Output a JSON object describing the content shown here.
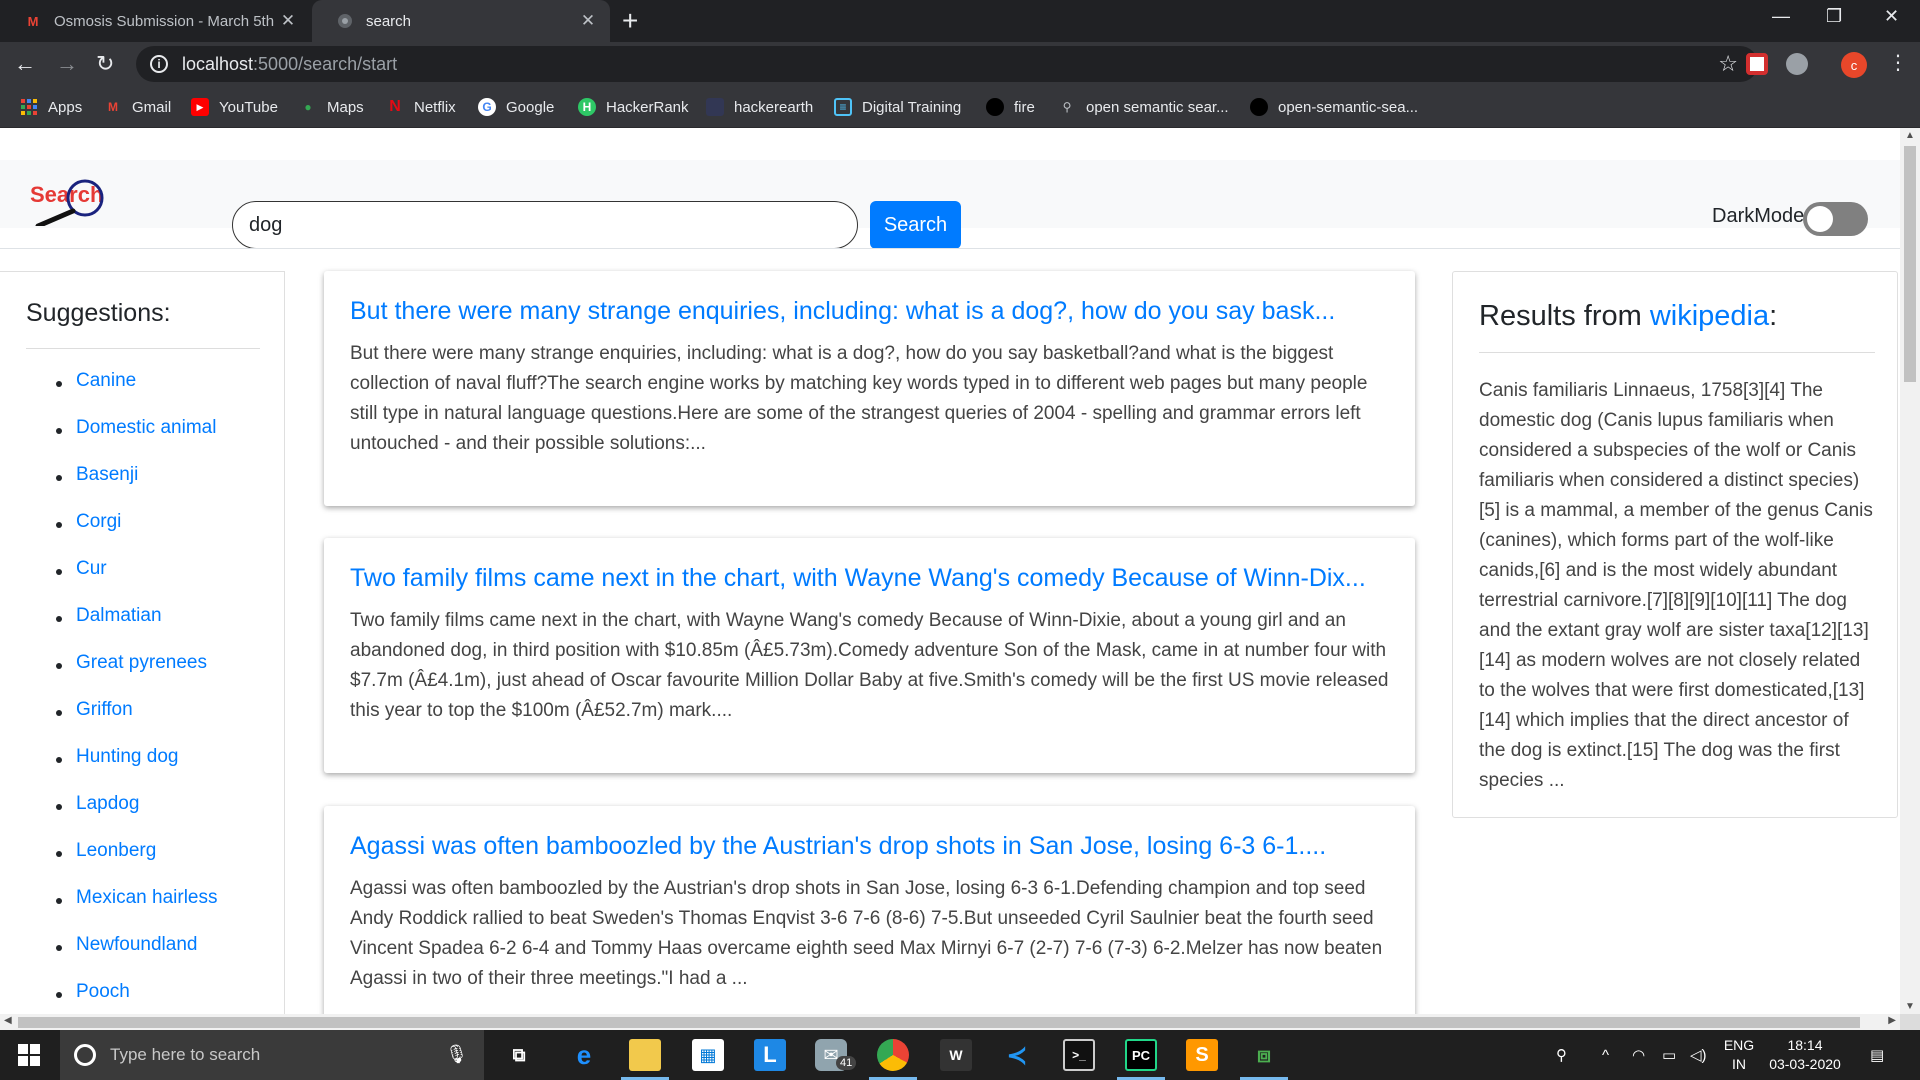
{
  "browser": {
    "tabs": [
      {
        "title": "Osmosis Submission - March 5th",
        "icon": "gmail-icon"
      },
      {
        "title": "search",
        "icon": "globe-icon"
      }
    ],
    "url_host": "localhost",
    "url_path": ":5000/search/start",
    "bookmarks": [
      "Apps",
      "Gmail",
      "YouTube",
      "Maps",
      "Netflix",
      "Google",
      "HackerRank",
      "hackerearth",
      "Digital Training",
      "fire",
      "open semantic sear...",
      "open-semantic-sea..."
    ],
    "profile_initial": "c"
  },
  "header": {
    "logo_text": "Search",
    "search_value": "dog",
    "search_button": "Search",
    "darkmode_label": "DarkMode",
    "darkmode_on": false
  },
  "suggestions": {
    "title": "Suggestions:",
    "items": [
      "Canine",
      "Domestic animal",
      "Basenji",
      "Corgi",
      "Cur",
      "Dalmatian",
      "Great pyrenees",
      "Griffon",
      "Hunting dog",
      "Lapdog",
      "Leonberg",
      "Mexican hairless",
      "Newfoundland",
      "Pooch"
    ]
  },
  "results": [
    {
      "title": "But there were many strange enquiries, including: what is a dog?, how do you say bask...",
      "snippet": "But there were many strange enquiries, including: what is a dog?, how do you say basketball?and what is the biggest collection of naval fluff?The search engine works by matching key words typed in to different web pages but many people still type in natural language questions.Here are some of the strangest queries of 2004 - spelling and grammar errors left untouched - and their possible solutions:..."
    },
    {
      "title": "Two family films came next in the chart, with Wayne Wang's comedy Because of Winn-Dix...",
      "snippet": "Two family films came next in the chart, with Wayne Wang's comedy Because of Winn-Dixie, about a young girl and an abandoned dog, in third position with $10.85m (Â£5.73m).Comedy adventure Son of the Mask, came in at number four with $7.7m (Â£4.1m), just ahead of Oscar favourite Million Dollar Baby at five.Smith's comedy will be the first US movie released this year to top the $100m (Â£52.7m) mark...."
    },
    {
      "title": "Agassi was often bamboozled by the Austrian's drop shots in San Jose, losing 6-3 6-1....",
      "snippet": "Agassi was often bamboozled by the Austrian's drop shots in San Jose, losing 6-3 6-1.Defending champion and top seed Andy Roddick rallied to beat Sweden's Thomas Enqvist 3-6 7-6 (8-6) 7-5.But unseeded Cyril Saulnier beat the fourth seed Vincent Spadea 6-2 6-4 and Tommy Haas overcame eighth seed Max Mirnyi 6-7 (2-7) 7-6 (7-3) 6-2.Melzer has now beaten Agassi in two of their three meetings.\"I had a ..."
    }
  ],
  "wikipedia": {
    "title_prefix": "Results from ",
    "title_link": "wikipedia",
    "title_suffix": ":",
    "text": "Canis familiaris Linnaeus, 1758[3][4] The domestic dog (Canis lupus familiaris when considered a subspecies of the wolf or Canis familiaris when considered a distinct species)[5] is a mammal, a member of the genus Canis (canines), which forms part of the wolf-like canids,[6] and is the most widely abundant terrestrial carnivore.[7][8][9][10][11] The dog and the extant gray wolf are sister taxa[12][13][14] as modern wolves are not closely related to the wolves that were first domesticated,[13][14] which implies that the direct ancestor of the dog is extinct.[15] The dog was the first species ..."
  },
  "taskbar": {
    "search_placeholder": "Type here to search",
    "mail_badge": "41",
    "lang_line1": "ENG",
    "lang_line2": "IN",
    "time": "18:14",
    "date": "03-03-2020"
  },
  "colors": {
    "accent": "#007bff",
    "chrome_dark": "#202124",
    "chrome_mid": "#35363a"
  }
}
